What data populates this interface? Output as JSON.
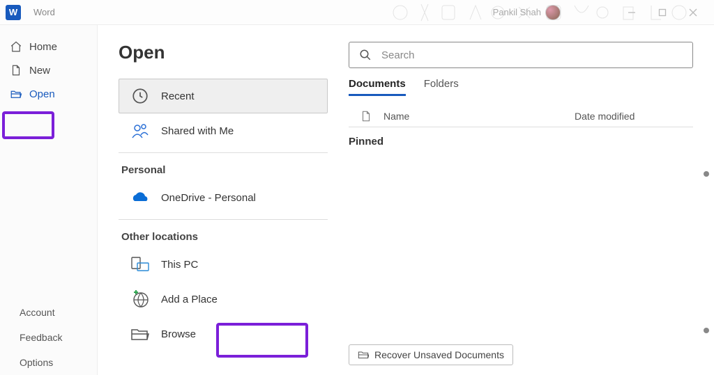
{
  "app": {
    "name": "Word",
    "user_name": "Pankil Shah"
  },
  "nav": {
    "home": "Home",
    "new": "New",
    "open": "Open",
    "account": "Account",
    "feedback": "Feedback",
    "options": "Options"
  },
  "page": {
    "title": "Open"
  },
  "locations": {
    "recent": "Recent",
    "shared": "Shared with Me",
    "heading_personal": "Personal",
    "onedrive": "OneDrive - Personal",
    "heading_other": "Other locations",
    "thispc": "This PC",
    "addplace": "Add a Place",
    "browse": "Browse"
  },
  "search": {
    "placeholder": "Search"
  },
  "tabs": {
    "documents": "Documents",
    "folders": "Folders"
  },
  "columns": {
    "name": "Name",
    "date": "Date modified"
  },
  "sections": {
    "pinned": "Pinned"
  },
  "recover": {
    "label": "Recover Unsaved Documents"
  }
}
